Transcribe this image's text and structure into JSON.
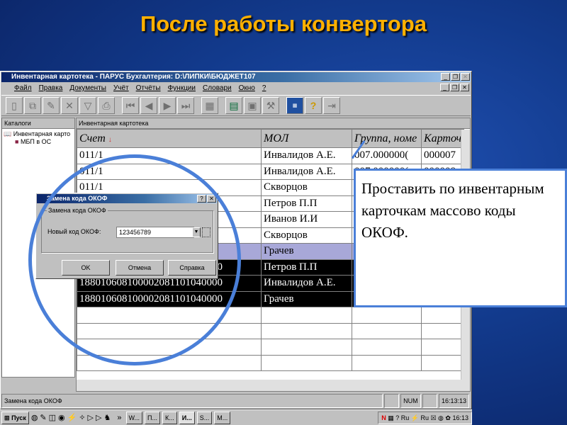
{
  "slide": {
    "title": "После работы конвертора",
    "callout": "Проставить по инвентарным карточкам массово коды ОКОФ."
  },
  "window": {
    "title": "Инвентарная картотека - ПАРУС Бухгалтерия: D:\\ЛИПКИ\\БЮДЖЕТ107",
    "menu": [
      "Файл",
      "Правка",
      "Документы",
      "Учёт",
      "Отчёты",
      "Функции",
      "Словари",
      "Окно",
      "?"
    ],
    "left_panel": {
      "header": "Каталоги",
      "items": [
        "Инвентарная карто",
        "МБП в ОС"
      ]
    },
    "right_panel": {
      "header": "Инвентарная картотека"
    },
    "table": {
      "columns": [
        "Счет",
        "МОЛ",
        "Группа, номе",
        "Карточ"
      ],
      "rows": [
        [
          "011/1",
          "Инвалидов А.Е.",
          "007.000000(",
          "000007"
        ],
        [
          "011/1",
          "Инвалидов А.Е.",
          "007.000000(",
          "000008"
        ],
        [
          "011/1",
          "Скворцов",
          "",
          ""
        ],
        [
          "",
          "Петров П.П",
          "",
          ""
        ],
        [
          "",
          "Иванов И.И",
          "",
          ""
        ],
        [
          "",
          "Скворцов",
          "",
          ""
        ],
        [
          "",
          "Грачев",
          "",
          ""
        ],
        [
          "188010608100002081101040000",
          "Петров П.П",
          "",
          ""
        ],
        [
          "188010608100002081101040000",
          "Инвалидов А.Е.",
          "",
          ""
        ],
        [
          "188010608100002081101040000",
          "Грачев",
          "",
          ""
        ]
      ]
    },
    "status": {
      "text": "Замена кода ОКОФ",
      "num": "NUM",
      "time": "16:13:13"
    }
  },
  "dialog": {
    "title": "Замена кода ОКОФ",
    "group": "Замена кода ОКОФ",
    "label": "Новый код ОКОФ:",
    "value": "123456789",
    "ok": "OK",
    "cancel": "Отмена",
    "help": "Справка"
  },
  "taskbar": {
    "start": "Пуск",
    "items": [
      "W...",
      "П...",
      "К...",
      "И...",
      "S...",
      "М..."
    ],
    "clock": "16:13"
  }
}
